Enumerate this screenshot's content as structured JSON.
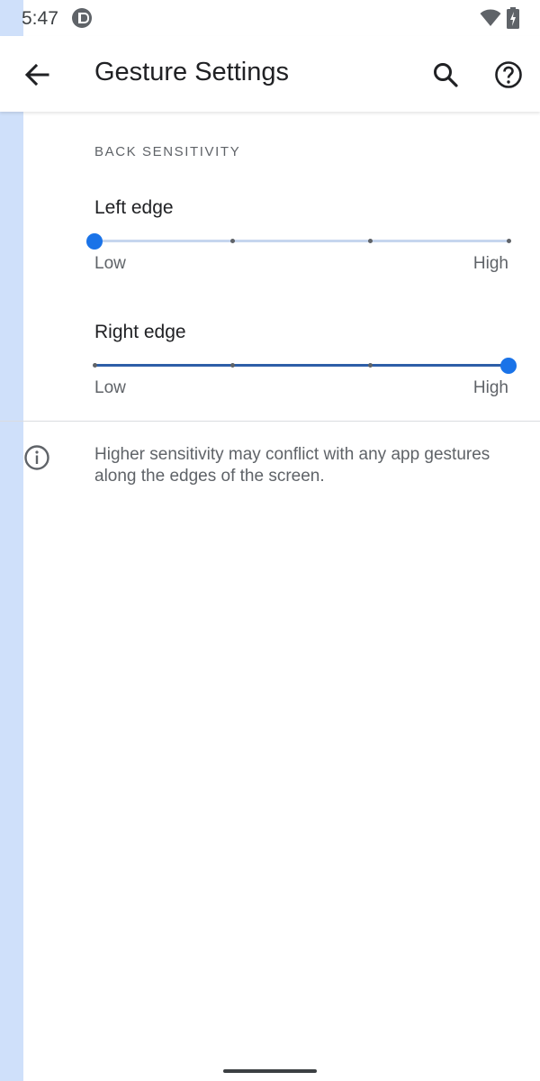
{
  "status_bar": {
    "time": "5:47",
    "icons": [
      "app-notification-icon",
      "wifi-icon",
      "battery-charging-icon"
    ]
  },
  "app_bar": {
    "title": "Gesture Settings",
    "icons": [
      "back-arrow-icon",
      "search-icon",
      "help-icon"
    ]
  },
  "section": {
    "header": "BACK SENSITIVITY"
  },
  "sliders": [
    {
      "title": "Left edge",
      "min_label": "Low",
      "max_label": "High",
      "steps": 4,
      "value_index": 0
    },
    {
      "title": "Right edge",
      "min_label": "Low",
      "max_label": "High",
      "steps": 4,
      "value_index": 3
    }
  ],
  "footer": {
    "icon": "info-icon",
    "text": "Higher sensitivity may conflict with any app gestures along the edges of the screen."
  },
  "colors": {
    "accent": "#1a73e8",
    "active_track": "#2d5ea8",
    "inactive_track": "#c6d6ee",
    "edge_highlight": "#cfe0fa"
  }
}
